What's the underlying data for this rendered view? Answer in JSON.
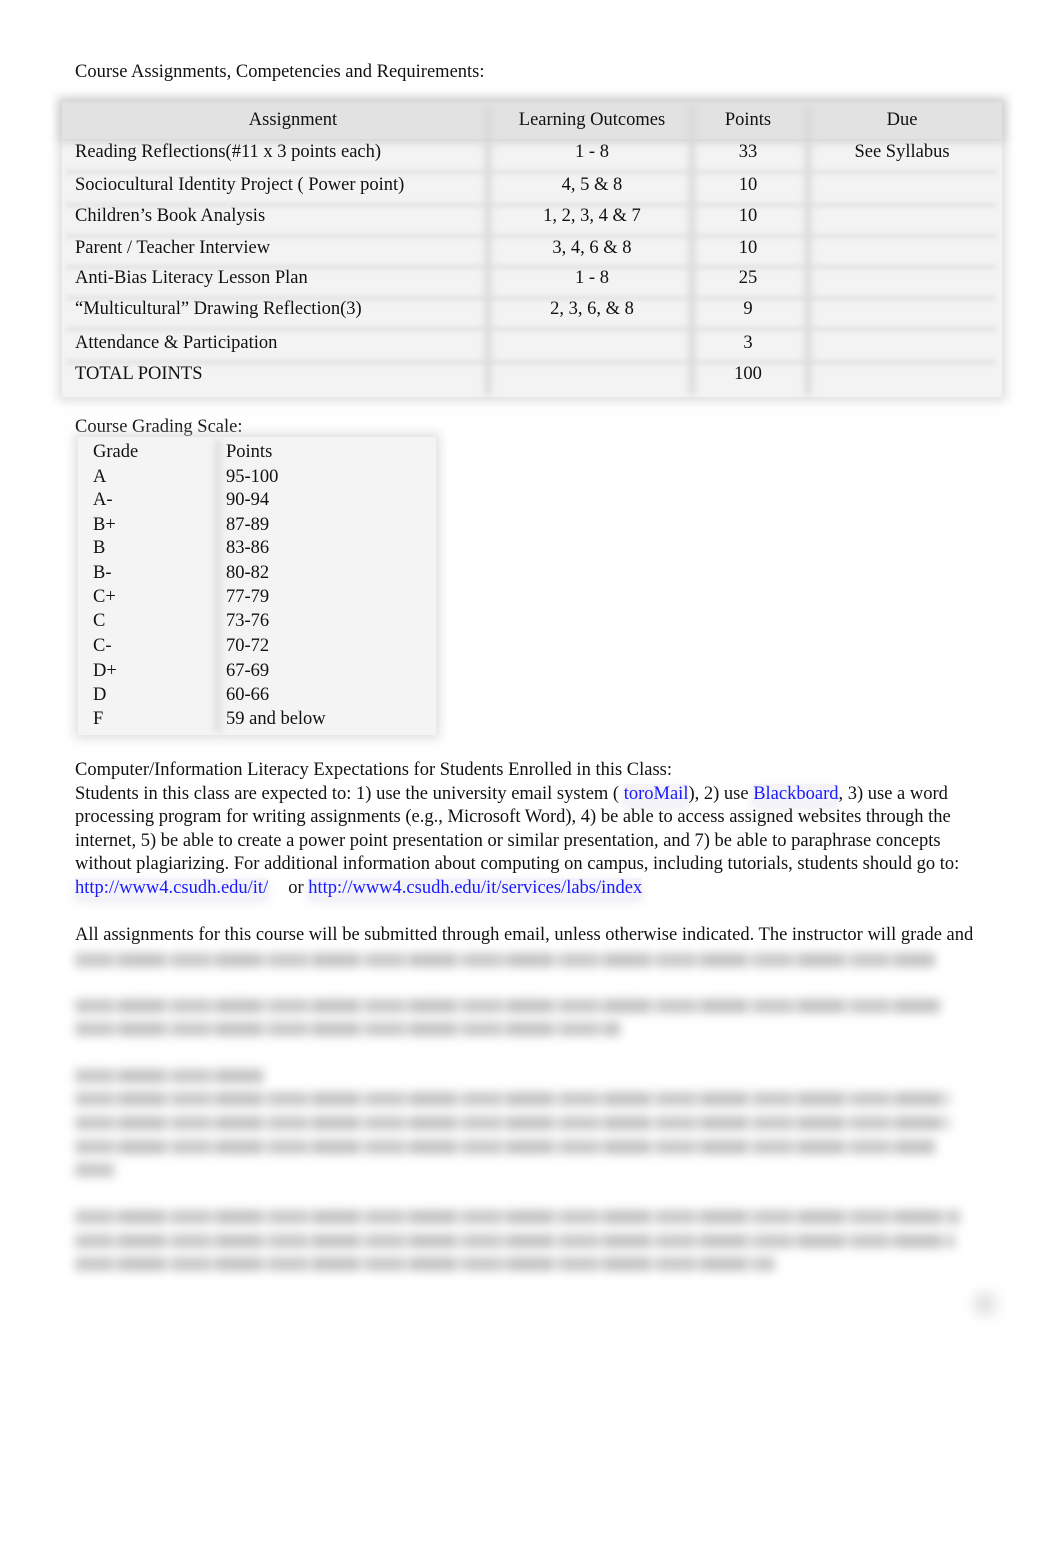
{
  "assignments_section": {
    "heading": "Course Assignments, Competencies and Requirements:",
    "columns": [
      "Assignment",
      "Learning Outcomes",
      "Points",
      "Due"
    ],
    "rows": [
      {
        "assignment": "Reading Reflections(#11 x 3 points each)",
        "outcomes": "1 - 8",
        "points": "33",
        "due": "See Syllabus"
      },
      {
        "assignment": "Sociocultural Identity Project ( Power point)",
        "outcomes": "4, 5 & 8",
        "points": "10",
        "due": ""
      },
      {
        "assignment": "Children’s Book Analysis",
        "outcomes": "1, 2, 3, 4 & 7",
        "points": "10",
        "due": ""
      },
      {
        "assignment": "Parent / Teacher Interview",
        "outcomes": "3, 4, 6 & 8",
        "points": "10",
        "due": ""
      },
      {
        "assignment": "Anti-Bias Literacy Lesson Plan",
        "outcomes": "1 - 8",
        "points": "25",
        "due": ""
      },
      {
        "assignment": "“Multicultural” Drawing Reflection(3)",
        "outcomes": "2, 3, 6, & 8",
        "points": "9",
        "due": ""
      },
      {
        "assignment": "Attendance & Participation",
        "outcomes": "",
        "points": "3",
        "due": ""
      },
      {
        "assignment": "TOTAL POINTS",
        "outcomes": "",
        "points": "100",
        "due": ""
      }
    ]
  },
  "grading_section": {
    "heading": "Course Grading Scale:",
    "columns": [
      "Grade",
      "Points"
    ],
    "rows": [
      {
        "grade": "A",
        "points": "95-100"
      },
      {
        "grade": "A-",
        "points": "90-94"
      },
      {
        "grade": "B+",
        "points": "87-89"
      },
      {
        "grade": "B",
        "points": "83-86"
      },
      {
        "grade": "B-",
        "points": "80-82"
      },
      {
        "grade": "C+",
        "points": "77-79"
      },
      {
        "grade": "C",
        "points": "73-76"
      },
      {
        "grade": "C-",
        "points": "70-72"
      },
      {
        "grade": "D+",
        "points": "67-69"
      },
      {
        "grade": "D",
        "points": "60-66"
      },
      {
        "grade": "F",
        "points": "59 and below"
      }
    ]
  },
  "literacy_section": {
    "heading": "Computer/Information Literacy Expectations for Students Enrolled in this Class:",
    "line1_a": "Students in this class are expected to: 1) use the university email system ( ",
    "link_toromail": "toroMail",
    "line1_b": "), 2) use ",
    "link_blackboard": "Blackboard",
    "line1_c": ", 3) use a word",
    "line2": "processing program for writing assignments (e.g., Microsoft Word), 4) be able to access assigned websites through the",
    "line3": "internet, 5) be able to create a power point presentation or similar presentation, and 7) be able to paraphrase concepts",
    "line4": "without plagiarizing. For additional information about computing on campus, including tutorials, students should go to:",
    "link_it": "http://www4.csudh.edu/it/",
    "or_text": "or",
    "link_labs": "http://www4.csudh.edu/it/services/labs/index"
  },
  "submission_section": {
    "line1": "All assignments for this course will be submitted through email, unless otherwise indicated. The instructor will grade and"
  },
  "colors": {
    "link": "#1a1aff",
    "text": "#111111",
    "table_header_bg": "#e2e2e2",
    "table_bg": "#f3f3f3"
  }
}
